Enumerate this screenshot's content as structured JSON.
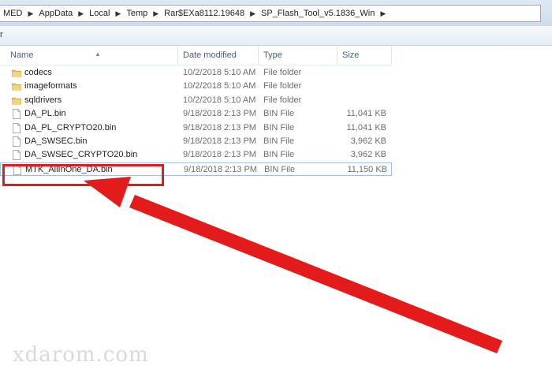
{
  "address_bar": {
    "crumbs": [
      "MED",
      "AppData",
      "Local",
      "Temp",
      "Rar$EXa8112.19648",
      "SP_Flash_Tool_v5.1836_Win"
    ]
  },
  "toolbar": {
    "fragment": "r"
  },
  "columns": {
    "name": "Name",
    "date": "Date modified",
    "type": "Type",
    "size": "Size"
  },
  "files": [
    {
      "name": "codecs",
      "date": "10/2/2018 5:10 AM",
      "type": "File folder",
      "size": "",
      "icon": "folder-icon"
    },
    {
      "name": "imageformats",
      "date": "10/2/2018 5:10 AM",
      "type": "File folder",
      "size": "",
      "icon": "folder-icon"
    },
    {
      "name": "sqldrivers",
      "date": "10/2/2018 5:10 AM",
      "type": "File folder",
      "size": "",
      "icon": "folder-icon"
    },
    {
      "name": "DA_PL.bin",
      "date": "9/18/2018 2:13 PM",
      "type": "BIN File",
      "size": "11,041 KB",
      "icon": "file-icon"
    },
    {
      "name": "DA_PL_CRYPTO20.bin",
      "date": "9/18/2018 2:13 PM",
      "type": "BIN File",
      "size": "11,041 KB",
      "icon": "file-icon"
    },
    {
      "name": "DA_SWSEC.bin",
      "date": "9/18/2018 2:13 PM",
      "type": "BIN File",
      "size": "3,962 KB",
      "icon": "file-icon"
    },
    {
      "name": "DA_SWSEC_CRYPTO20.bin",
      "date": "9/18/2018 2:13 PM",
      "type": "BIN File",
      "size": "3,962 KB",
      "icon": "file-icon"
    },
    {
      "name": "MTK_AllInOne_DA.bin",
      "date": "9/18/2018 2:13 PM",
      "type": "BIN File",
      "size": "11,150 KB",
      "icon": "file-icon",
      "selected": true
    }
  ],
  "annotation": {
    "color": "#e41b1b"
  },
  "watermark": "xdarom.com"
}
